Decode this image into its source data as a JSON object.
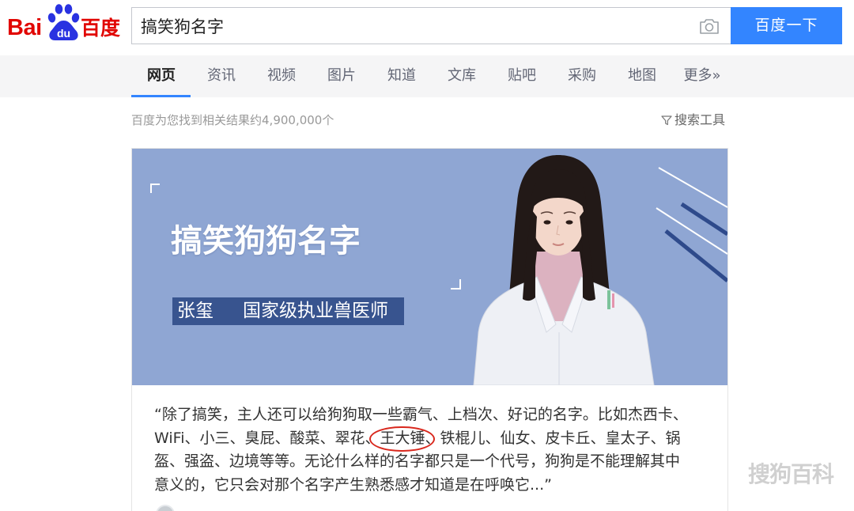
{
  "logo": {
    "text_left": "Bai",
    "paw_text": "du",
    "text_right": "百度",
    "icon": "paw-icon"
  },
  "search": {
    "value": "搞笑狗名字",
    "camera_icon": "camera-icon",
    "button_label": "百度一下"
  },
  "nav": {
    "tabs": [
      {
        "label": "网页",
        "active": true
      },
      {
        "label": "资讯"
      },
      {
        "label": "视频"
      },
      {
        "label": "图片"
      },
      {
        "label": "知道"
      },
      {
        "label": "文库"
      },
      {
        "label": "贴吧"
      },
      {
        "label": "采购"
      },
      {
        "label": "地图"
      },
      {
        "label": "更多»"
      }
    ]
  },
  "results": {
    "count_text": "百度为您找到相关结果约4,900,000个",
    "tools_icon": "funnel-icon",
    "tools_label": "搜索工具"
  },
  "card": {
    "thumbnail": {
      "title": "搞笑狗狗名字",
      "presenter_name": "张玺",
      "presenter_title": "国家级执业兽医师"
    },
    "snippet": {
      "line_1": "“除了搞笑，主人还可以给狗狗取一些霸气、上档次、好记的名字。比如杰西卡、",
      "line_2_start": "WiFi、小三、臭屁、酸菜、翠花、",
      "line_2_circled": "王大锤",
      "line_2_end": "、铁棍儿、仙女、皮卡丘、皇太子、锅",
      "line_3": "盔、强盗、边境等等。无论什么样的名字都只是一个代号，狗狗是不能理解其中",
      "line_4": "意义的，它只会对那个名字产生熟悉感才知道是在呼唤它...”"
    },
    "source_avatar_icon": "avatar"
  },
  "watermark": "搜狗百科",
  "colors": {
    "accent": "#3385ff",
    "logo_red": "#e10602",
    "logo_blue": "#2932e1",
    "thumbnail_bg": "#8fa6d3",
    "nameplate_bg": "#38548f",
    "annotation_red": "#d9281d"
  }
}
